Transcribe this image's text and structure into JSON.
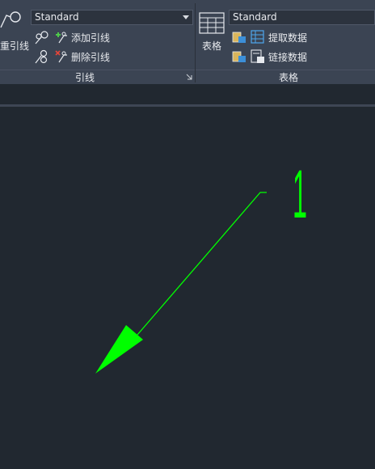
{
  "leader_panel": {
    "multileader_label": "重引线",
    "style_value": "Standard",
    "add_leader_label": "添加引线",
    "remove_leader_label": "删除引线",
    "title": "引线"
  },
  "table_panel": {
    "table_label": "表格",
    "style_value": "Standard",
    "extract_data_label": "提取数据",
    "link_data_label": "链接数据",
    "title": "表格"
  },
  "drawing": {
    "text_content": "1",
    "entity_color": "#00ff00"
  }
}
